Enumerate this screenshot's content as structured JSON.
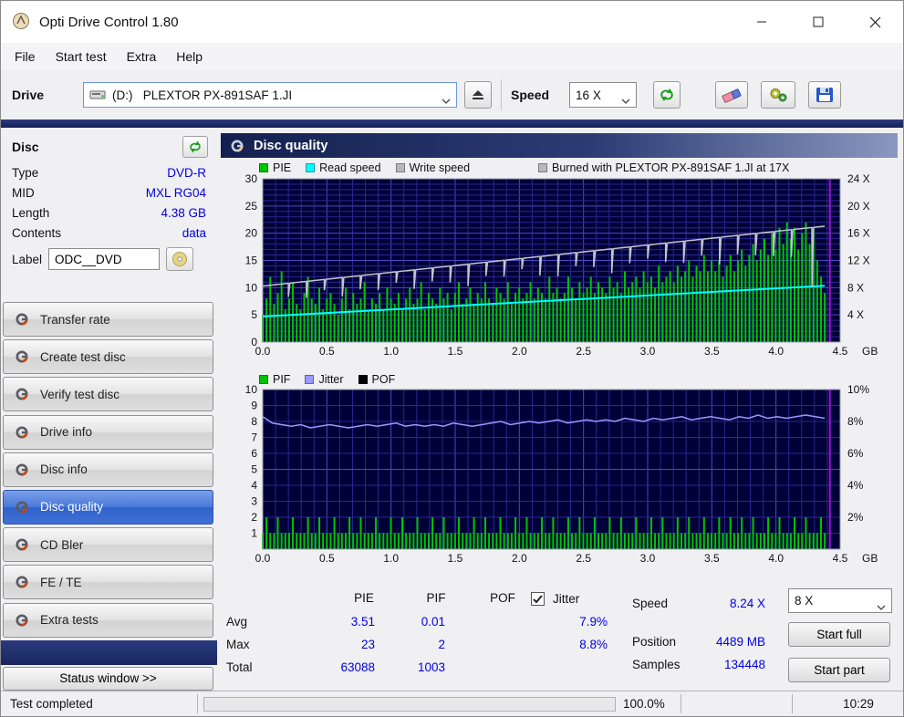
{
  "window": {
    "title": "Opti Drive Control 1.80"
  },
  "menu": [
    "File",
    "Start test",
    "Extra",
    "Help"
  ],
  "toolbar": {
    "drive_label": "Drive",
    "drive_value": "(D:)   PLEXTOR PX-891SAF 1.JI",
    "speed_label": "Speed",
    "speed_value": "16 X"
  },
  "sidebar": {
    "disc_header": "Disc",
    "fields": [
      {
        "label": "Type",
        "value": "DVD-R"
      },
      {
        "label": "MID",
        "value": "MXL RG04"
      },
      {
        "label": "Length",
        "value": "4.38 GB"
      },
      {
        "label": "Contents",
        "value": "data"
      }
    ],
    "label_label": "Label",
    "label_value": "ODC__DVD",
    "buttons": [
      "Transfer rate",
      "Create test disc",
      "Verify test disc",
      "Drive info",
      "Disc info",
      "Disc quality",
      "CD Bler",
      "FE / TE",
      "Extra tests"
    ],
    "selected_index": 5,
    "status_button": "Status window >>"
  },
  "main": {
    "header": "Disc quality",
    "legend1": [
      {
        "label": "PIE",
        "color": "#00c400"
      },
      {
        "label": "Read speed",
        "color": "#00ffff"
      },
      {
        "label": "Write speed",
        "color": "#b8b8c0"
      }
    ],
    "legend1_right": {
      "label": "Burned with PLEXTOR PX-891SAF 1.JI at 17X",
      "color": "#b8b8c0"
    },
    "legend2": [
      {
        "label": "PIF",
        "color": "#00c400"
      },
      {
        "label": "Jitter",
        "color": "#9999ff"
      },
      {
        "label": "POF",
        "color": "#000000"
      }
    ]
  },
  "chart_data": [
    {
      "type": "bar",
      "title": "PIE / Read speed / Write speed",
      "xlim": [
        0,
        4.5
      ],
      "x_minor": 0.1,
      "x_major": 0.5,
      "x_ticks": [
        0,
        0.5,
        1,
        1.5,
        2,
        2.5,
        3,
        3.5,
        4,
        4.5
      ],
      "x_suffix": "GB",
      "ylim": [
        0,
        30
      ],
      "y_minor": 1,
      "y_major": 5,
      "yticks": [
        0,
        5,
        10,
        15,
        20,
        25,
        30
      ],
      "right_labels": [
        {
          "at": 30,
          "label": "24 X"
        },
        {
          "at": 25,
          "label": "20 X"
        },
        {
          "at": 20,
          "label": "16 X"
        },
        {
          "at": 15,
          "label": "12 X"
        },
        {
          "at": 10,
          "label": "8 X"
        },
        {
          "at": 5,
          "label": "4 X"
        }
      ],
      "data_end": 4.38,
      "marker": 4.42,
      "series": [
        {
          "name": "PIE",
          "type": "bar",
          "color": "#00c400",
          "width": 2,
          "values": [
            5,
            8,
            12,
            7,
            9,
            13,
            6,
            8,
            11,
            7,
            6,
            9,
            12,
            8,
            7,
            10,
            6,
            8,
            9,
            7,
            5,
            8,
            10,
            6,
            9,
            7,
            8,
            11,
            6,
            8,
            7,
            9,
            6,
            10,
            8,
            7,
            9,
            6,
            8,
            10,
            7,
            8,
            11,
            6,
            9,
            8,
            7,
            10,
            8,
            9,
            6,
            9,
            11,
            7,
            8,
            10,
            7,
            9,
            8,
            11,
            8,
            7,
            10,
            9,
            8,
            11,
            7,
            9,
            10,
            8,
            9,
            11,
            8,
            10,
            9,
            8,
            12,
            9,
            10,
            8,
            9,
            12,
            10,
            8,
            11,
            9,
            10,
            12,
            9,
            11,
            10,
            9,
            12,
            10,
            11,
            9,
            13,
            10,
            11,
            12,
            10,
            13,
            11,
            12,
            10,
            14,
            11,
            12,
            13,
            11,
            14,
            12,
            13,
            15,
            12,
            14,
            13,
            16,
            13,
            15,
            13,
            15,
            12,
            14,
            16,
            13,
            15,
            17,
            14,
            16,
            18,
            15,
            17,
            19,
            16,
            20,
            17,
            21,
            18,
            22,
            19,
            21,
            17,
            20,
            22,
            18,
            21,
            15,
            12,
            9
          ]
        },
        {
          "name": "Read speed",
          "type": "line",
          "color": "#00ffff",
          "width": 2,
          "points": [
            [
              0,
              4.7
            ],
            [
              4.38,
              10.35
            ]
          ]
        },
        {
          "name": "Write speed",
          "type": "line-dips",
          "color": "#c4c4cc",
          "width": 1.5,
          "start": 10.3,
          "end": 21.3,
          "dips": [
            [
              0.2,
              2.5
            ],
            [
              0.34,
              3
            ],
            [
              0.48,
              2
            ],
            [
              0.62,
              3.5
            ],
            [
              0.76,
              2.5
            ],
            [
              0.9,
              3
            ],
            [
              1.04,
              2
            ],
            [
              1.18,
              3.5
            ],
            [
              1.32,
              2.5
            ],
            [
              1.46,
              3
            ],
            [
              1.6,
              4
            ],
            [
              1.74,
              2.5
            ],
            [
              1.88,
              3
            ],
            [
              2.02,
              2
            ],
            [
              2.16,
              3.5
            ],
            [
              2.3,
              4
            ],
            [
              2.44,
              2.5
            ],
            [
              2.58,
              3
            ],
            [
              2.72,
              4.5
            ],
            [
              2.86,
              3
            ],
            [
              3.0,
              2.5
            ],
            [
              3.14,
              3.5
            ],
            [
              3.28,
              4
            ],
            [
              3.42,
              3
            ],
            [
              3.56,
              5
            ],
            [
              3.7,
              3.5
            ],
            [
              3.84,
              4
            ],
            [
              3.98,
              4.5
            ],
            [
              4.12,
              5
            ],
            [
              4.28,
              11
            ]
          ]
        }
      ]
    },
    {
      "type": "bar",
      "title": "PIF / Jitter / POF",
      "xlim": [
        0,
        4.5
      ],
      "x_minor": 0.1,
      "x_major": 0.5,
      "x_ticks": [
        0,
        0.5,
        1,
        1.5,
        2,
        2.5,
        3,
        3.5,
        4,
        4.5
      ],
      "x_suffix": "GB",
      "ylim": [
        0,
        10
      ],
      "y_minor": 1,
      "y_major": 5,
      "yticks": [
        1,
        2,
        3,
        4,
        5,
        6,
        7,
        8,
        9,
        10
      ],
      "right_labels": [
        {
          "at": 10,
          "label": "10%"
        },
        {
          "at": 8,
          "label": "8%"
        },
        {
          "at": 6,
          "label": "6%"
        },
        {
          "at": 4,
          "label": "4%"
        },
        {
          "at": 2,
          "label": "2%"
        }
      ],
      "data_end": 4.38,
      "marker": 4.42,
      "series": [
        {
          "name": "PIF",
          "type": "bar",
          "color": "#00c400",
          "width": 2,
          "values": [
            1,
            2,
            1,
            1,
            2,
            1,
            1,
            1,
            2,
            1,
            1,
            1,
            2,
            1,
            1,
            2,
            1,
            1,
            1,
            2,
            1,
            1,
            1,
            2,
            1,
            1,
            2,
            1,
            1,
            1,
            2,
            1,
            1,
            1,
            2,
            1,
            1,
            2,
            1,
            1,
            1,
            2,
            1,
            1,
            1,
            2,
            1,
            1,
            2,
            1,
            1,
            1,
            2,
            1,
            1,
            1,
            2,
            1,
            1,
            2,
            1,
            1,
            1,
            2,
            1,
            1,
            1,
            2,
            1,
            1,
            2,
            1,
            1,
            1,
            2,
            1,
            1,
            2,
            1,
            1,
            1,
            2,
            1,
            1,
            2,
            1,
            1,
            1,
            2,
            1,
            1,
            1,
            2,
            1,
            1,
            2,
            1,
            1,
            1,
            2,
            1,
            1,
            1,
            2,
            1,
            1,
            2,
            1,
            1,
            1,
            2,
            1,
            1,
            2,
            1,
            1,
            1,
            2,
            1,
            1,
            1,
            2,
            1,
            1,
            2,
            1,
            1,
            2,
            1,
            1,
            2,
            1,
            1,
            1,
            2,
            1,
            1,
            2,
            1,
            1,
            1,
            2,
            1,
            1,
            2,
            1,
            1,
            1,
            2,
            1
          ]
        },
        {
          "name": "Jitter",
          "type": "line",
          "color": "#9999ff",
          "width": 1.5,
          "values": [
            8.3,
            7.9,
            7.8,
            7.7,
            7.8,
            7.6,
            7.7,
            7.8,
            7.7,
            7.6,
            7.7,
            7.8,
            7.7,
            7.8,
            7.9,
            7.7,
            7.8,
            7.7,
            7.8,
            7.7,
            7.9,
            7.8,
            7.7,
            7.8,
            7.9,
            8.0,
            7.8,
            7.9,
            8.0,
            7.9,
            8.0,
            8.1,
            7.9,
            8.0,
            8.1,
            8.0,
            8.1,
            8.0,
            8.2,
            8.1,
            8.0,
            8.2,
            8.1,
            8.2,
            8.3,
            8.1,
            8.2,
            8.3,
            8.2,
            8.1,
            8.3,
            8.2,
            8.4,
            8.2,
            8.3,
            8.2,
            8.3,
            8.4,
            8.3,
            8.2
          ]
        },
        {
          "name": "POF",
          "type": "bar",
          "color": "#000000",
          "width": 2,
          "values": []
        }
      ]
    }
  ],
  "stats": {
    "col_pie": "PIE",
    "col_pif": "PIF",
    "col_pof": "POF",
    "col_jitter": "Jitter",
    "jitter_checked": true,
    "row_avg": "Avg",
    "row_max": "Max",
    "row_total": "Total",
    "avg_pie": "3.51",
    "avg_pif": "0.01",
    "avg_jitter": "7.9%",
    "max_pie": "23",
    "max_pif": "2",
    "max_jitter": "8.8%",
    "total_pie": "63088",
    "total_pif": "1003"
  },
  "panel": {
    "speed_label": "Speed",
    "speed_value": "8.24 X",
    "position_label": "Position",
    "position_value": "4489 MB",
    "samples_label": "Samples",
    "samples_value": "134448",
    "speed_select": "8 X",
    "start_full": "Start full",
    "start_part": "Start part"
  },
  "statusbar": {
    "status": "Test completed",
    "progress_pct": 100.0,
    "progress_label": "100.0%",
    "time": "10:29"
  }
}
